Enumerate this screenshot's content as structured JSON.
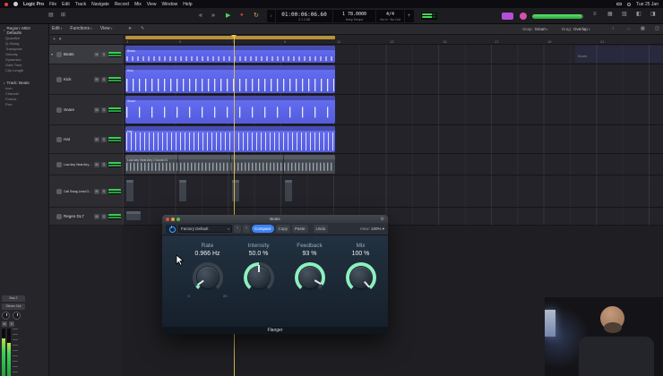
{
  "colors": {
    "region_blue": "#5a62e6",
    "knob_ring": "#8df0bf",
    "accent_blue": "#3b82f7",
    "play_green": "#4fd35a",
    "record_red": "#e0443e",
    "meter_green": "#46d65a",
    "playhead_yellow": "#e3c452",
    "cycle_yellow": "#b8923a",
    "purple_button": "#b44fd8",
    "magenta_button": "#d84fb0"
  },
  "menubar": {
    "items": [
      "Logic Pro",
      "File",
      "Edit",
      "Track",
      "Navigate",
      "Record",
      "Mix",
      "View",
      "Window",
      "Help"
    ],
    "clock": "Tue 25 Jan"
  },
  "transport": {
    "lcd": {
      "icon": "♪",
      "time_main": "01:00:06:06.60",
      "time_sub": "3 1 2 58",
      "tempo_main": "1  78.0000",
      "tempo_sub": "Keep Tempo",
      "sig_main": "4/4",
      "sig_sub": "No In · No Out",
      "plus": "+"
    }
  },
  "subtoolbar": {
    "menus": [
      "Edit",
      "Functions",
      "View"
    ],
    "snap_label": "Snap:",
    "snap_value": "Smart",
    "drag_label": "Drag:",
    "drag_value": "Overlap"
  },
  "inspector": {
    "region_header": "Region: MIDI Defaults",
    "region_rows": [
      "Quantize",
      "Q-Swing",
      "Transpose",
      "Velocity",
      "Dynamics",
      "Gate Time",
      "Clip Length"
    ],
    "track_header": "Track: Beats",
    "track_rows": [
      "Icon",
      "Channel",
      "Freeze",
      "Flex"
    ]
  },
  "ruler": {
    "numbers": [
      "3",
      "5",
      "7",
      "9",
      "11",
      "13",
      "15",
      "17",
      "19",
      "21"
    ]
  },
  "track_controls": {
    "mute": "M",
    "solo": "S"
  },
  "tracks": [
    {
      "name": "Beats"
    },
    {
      "name": "Kick"
    },
    {
      "name": "Snare"
    },
    {
      "name": "Hat"
    },
    {
      "name": "Low-key Heat Airy Chords 01"
    },
    {
      "name": "Cali Swag Lead Guitar"
    },
    {
      "name": "Regen DL7"
    }
  ],
  "regions": {
    "beats": "Beats",
    "kick": "Kick",
    "snare": "Snare",
    "hat": "Hat",
    "lowkey": "Low-key Heat Airy Chords 01",
    "far_beats": "Beats"
  },
  "output_strip": {
    "out1": "Bus 2",
    "out2": "Stereo Out",
    "mute": "M",
    "solo": "S"
  },
  "plugin": {
    "window_title": "Beats",
    "preset": "Factory Default",
    "prev": "‹",
    "next": "›",
    "compare": "Compare",
    "copy": "Copy",
    "paste": "Paste",
    "undo": "Undo",
    "view_label": "View:",
    "view_value": "100% ▾",
    "footer": "Flanger",
    "knobs": [
      {
        "label": "Rate",
        "value": "0.966 Hz",
        "min": "0",
        "max": "20",
        "pct": 5
      },
      {
        "label": "Intensity",
        "value": "50.0 %",
        "min": "",
        "max": "",
        "pct": 50
      },
      {
        "label": "Feedback",
        "value": "93 %",
        "min": "",
        "max": "",
        "pct": 93
      },
      {
        "label": "Mix",
        "value": "100 %",
        "min": "",
        "max": "",
        "pct": 100
      }
    ]
  }
}
